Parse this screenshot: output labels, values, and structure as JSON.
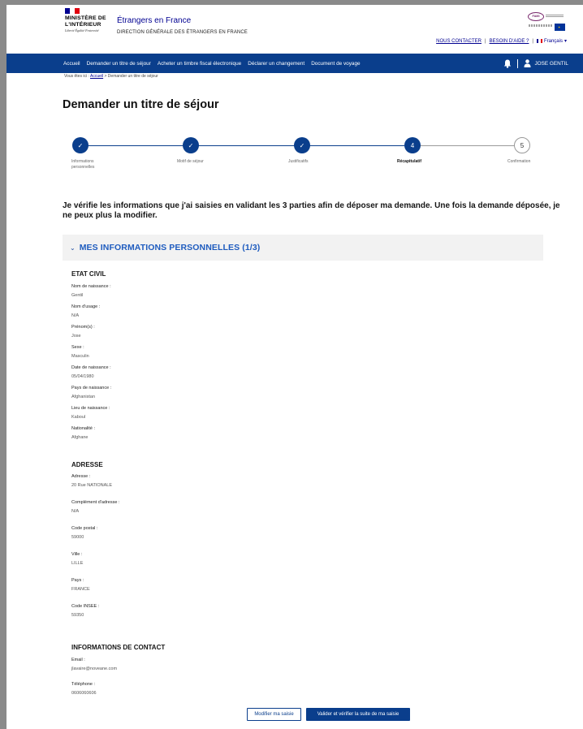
{
  "header": {
    "ministry": "MINISTÈRE DE L'INTÉRIEUR",
    "devise": "Liberté Égalité Fraternité",
    "site_title": "Étrangers en France",
    "site_subtitle": "DIRECTION GÉNÉRALE DES ÉTRANGERS EN FRANCE",
    "fami_label": "FAMI",
    "contact_link": "NOUS CONTACTER",
    "help_link": "BESOIN D'AIDE ?",
    "separator": "|",
    "language": "Français",
    "language_caret": "▾"
  },
  "nav": {
    "items": [
      "Accueil",
      "Demander un titre de séjour",
      "Acheter un timbre fiscal électronique",
      "Déclarer un changement",
      "Document de voyage"
    ],
    "user_name": "JOSE GENTIL"
  },
  "breadcrumb": {
    "prefix": "Vous êtes ici :",
    "home": "Accueil",
    "current": "> Demander un titre de séjour"
  },
  "page_title": "Demander un titre de séjour",
  "stepper": {
    "check_glyph": "✓",
    "steps": [
      {
        "label": "Informations personnelles",
        "state": "done",
        "number": ""
      },
      {
        "label": "Motif de séjour",
        "state": "done",
        "number": ""
      },
      {
        "label": "Justificatifs",
        "state": "done",
        "number": ""
      },
      {
        "label": "Récapitulatif",
        "state": "current",
        "number": "4"
      },
      {
        "label": "Confirmation",
        "state": "todo",
        "number": "5"
      }
    ]
  },
  "intro": "Je vérifie les informations que j'ai saisies en validant les 3 parties afin de déposer ma demande. Une fois la demande déposée, je ne peux plus la modifier.",
  "section": {
    "chevron": "⌄",
    "title": "MES INFORMATIONS PERSONNELLES (1/3)"
  },
  "etat_civil": {
    "heading": "ETAT CIVIL",
    "fields": [
      {
        "label": "Nom de naissance :",
        "value": "Gentil"
      },
      {
        "label": "Nom d'usage :",
        "value": "N/A"
      },
      {
        "label": "Prénom(s) :",
        "value": "Jose"
      },
      {
        "label": "Sexe :",
        "value": "Masculin"
      },
      {
        "label": "Date de naissance :",
        "value": "05/04/1980"
      },
      {
        "label": "Pays de naissance :",
        "value": "Afghanistan"
      },
      {
        "label": "Lieu de naissance :",
        "value": "Kaboul"
      },
      {
        "label": "Nationalité :",
        "value": "Afghane"
      }
    ]
  },
  "adresse": {
    "heading": "ADRESSE",
    "fields": [
      {
        "label": "Adresse :",
        "value": "20 Rue NATIONALE"
      },
      {
        "label": "Complément d'adresse :",
        "value": "N/A"
      },
      {
        "label": "Code postal :",
        "value": "59000"
      },
      {
        "label": "Ville :",
        "value": "LILLE"
      },
      {
        "label": "Pays :",
        "value": "FRANCE"
      },
      {
        "label": "Code INSEE :",
        "value": "59350"
      }
    ]
  },
  "contact": {
    "heading": "INFORMATIONS DE CONTACT",
    "fields": [
      {
        "label": "Email :",
        "value": "jlavaire@noveane.com"
      },
      {
        "label": "Téléphone :",
        "value": "0606060606"
      }
    ]
  },
  "buttons": {
    "modify": "Modifier ma saisie",
    "validate": "Valider et vérifier la suite de ma saisie"
  },
  "colors": {
    "primary": "#0a3e8c",
    "link": "#000091",
    "section_title": "#1f5cbf"
  }
}
